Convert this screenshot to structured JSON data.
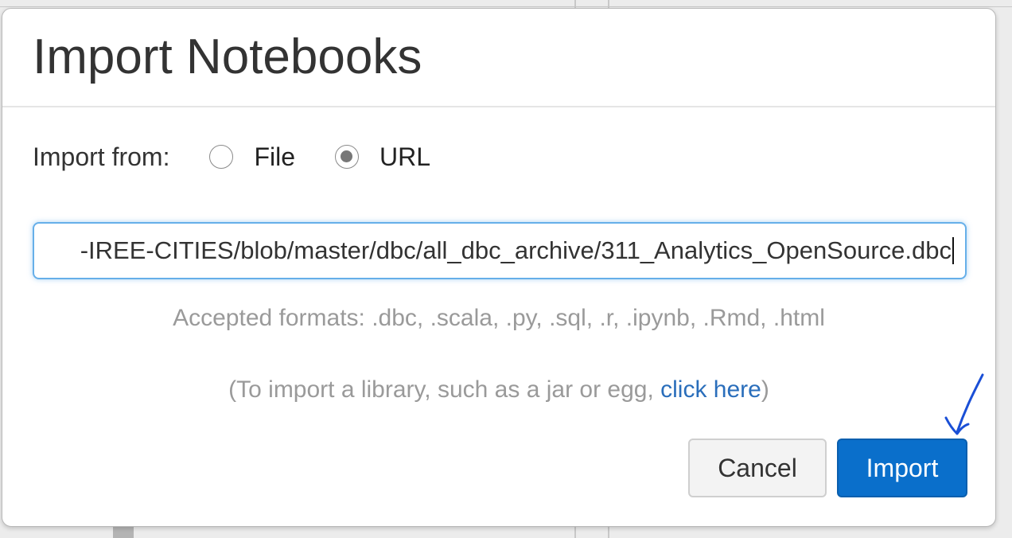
{
  "dialog": {
    "title": "Import Notebooks",
    "import_from_label": "Import from:",
    "options": [
      {
        "label": "File",
        "selected": false
      },
      {
        "label": "URL",
        "selected": true
      }
    ],
    "url_value": "-IREE-CITIES/blob/master/dbc/all_dbc_archive/311_Analytics_OpenSource.dbc",
    "accepted_formats": "Accepted formats: .dbc, .scala, .py, .sql, .r, .ipynb, .Rmd, .html",
    "library_note_prefix": "(To import a library, such as a jar or egg, ",
    "library_link": "click here",
    "library_note_suffix": ")",
    "cancel_label": "Cancel",
    "import_label": "Import"
  },
  "colors": {
    "primary": "#0a6fcb",
    "link": "#2a6ebb",
    "annotation_arrow": "#1a4fd6"
  },
  "icons": {
    "annotation": "hand-drawn-arrow-icon"
  }
}
